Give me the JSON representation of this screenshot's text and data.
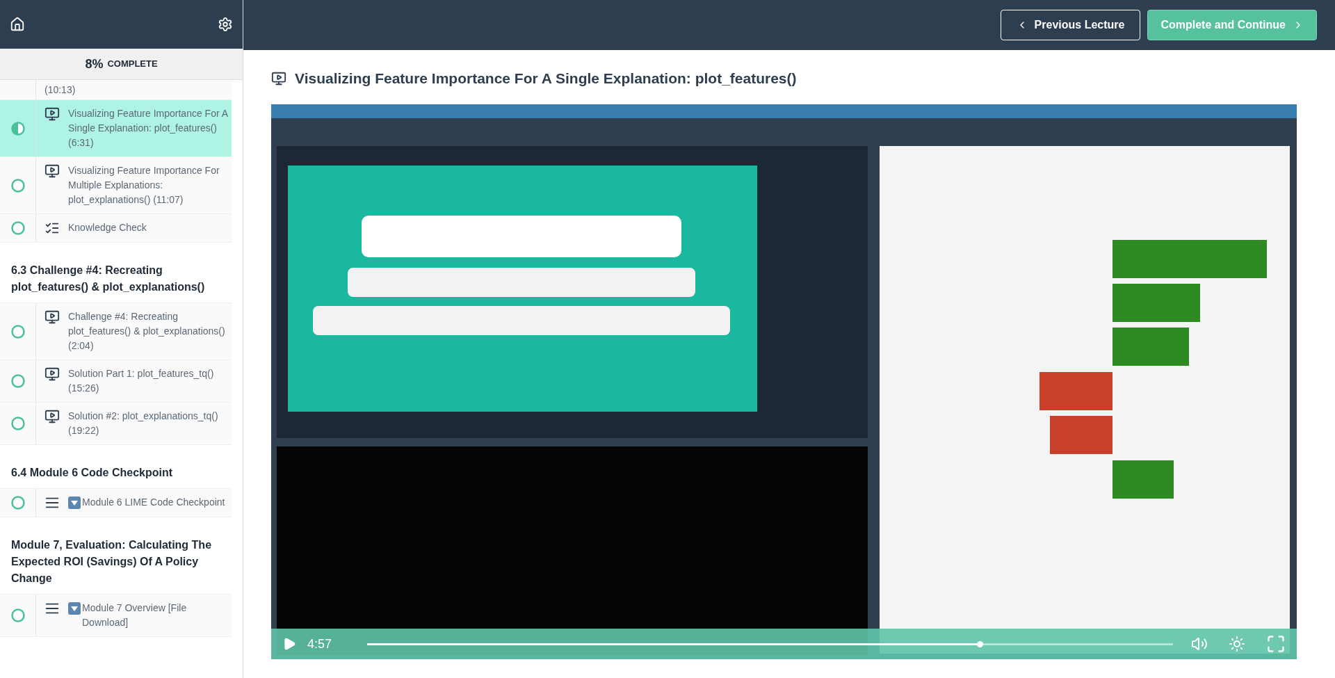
{
  "progress": {
    "percent": "8%",
    "label": "COMPLETE"
  },
  "sections": [
    {
      "continued_text": "(10:13)",
      "lectures": [
        {
          "kind": "video",
          "title": "Visualizing Feature Importance For A Single Explanation: plot_features() (6:31)",
          "in_progress": true,
          "selected": true
        },
        {
          "kind": "video",
          "title": "Visualizing Feature Importance For Multiple Explanations: plot_explanations() (11:07)",
          "in_progress": false,
          "selected": false
        },
        {
          "kind": "quiz",
          "title": "Knowledge Check",
          "in_progress": false,
          "selected": false
        }
      ]
    },
    {
      "title": "6.3 Challenge #4: Recreating plot_features() & plot_explanations()",
      "lectures": [
        {
          "kind": "video",
          "title": "Challenge #4: Recreating plot_features() & plot_explanations() (2:04)",
          "in_progress": false,
          "selected": false
        },
        {
          "kind": "video",
          "title": "Solution Part 1: plot_features_tq() (15:26)",
          "in_progress": false,
          "selected": false
        },
        {
          "kind": "video",
          "title": "Solution #2: plot_explanations_tq() (19:22)",
          "in_progress": false,
          "selected": false
        }
      ]
    },
    {
      "title": "6.4 Module 6 Code Checkpoint",
      "lectures": [
        {
          "kind": "text",
          "download_badge": true,
          "title": "Module 6 LIME Code Checkpoint",
          "in_progress": false,
          "selected": false
        }
      ]
    },
    {
      "title": "Module 7, Evaluation: Calculating The Expected ROI (Savings) Of A Policy Change",
      "lectures": [
        {
          "kind": "text",
          "download_badge": true,
          "title": "Module 7 Overview [File Download]",
          "in_progress": false,
          "selected": false
        }
      ]
    }
  ],
  "nav": {
    "previous": "Previous Lecture",
    "next": "Complete and Continue"
  },
  "lecture_title": "Visualizing Feature Importance For A Single Explanation: plot_features()",
  "video": {
    "kind": "picture",
    "time": "4:57",
    "progress": {
      "level": 0.76
    }
  }
}
